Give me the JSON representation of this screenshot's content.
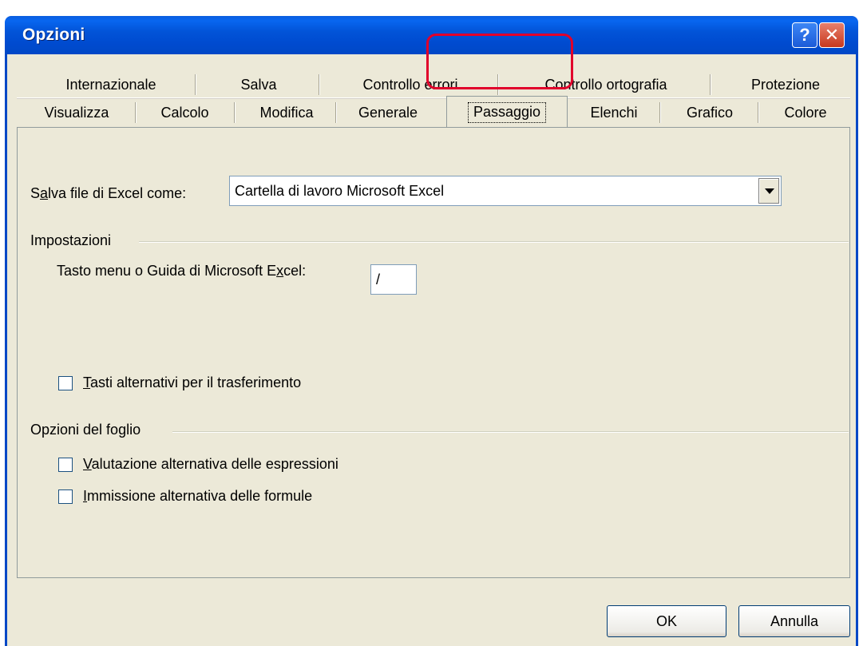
{
  "window": {
    "title": "Opzioni",
    "help_label": "?",
    "close_label": "✕"
  },
  "tabs": {
    "row1": [
      "Internazionale",
      "Salva",
      "Controllo errori",
      "Controllo ortografia",
      "Protezione"
    ],
    "row2": [
      "Visualizza",
      "Calcolo",
      "Modifica",
      "Generale",
      "Passaggio",
      "Elenchi",
      "Grafico",
      "Colore"
    ],
    "active": "Passaggio"
  },
  "transition": {
    "save_as_label_pre": "S",
    "save_as_label_ul": "a",
    "save_as_label_post": "lva file di Excel come:",
    "save_as_value": "Cartella di lavoro Microsoft Excel",
    "settings_group": "Impostazioni",
    "menu_key_label_pre": "Tasto menu o Guida di Microsoft E",
    "menu_key_label_ul": "x",
    "menu_key_label_post": "cel:",
    "menu_key_value": "/",
    "alt_nav_ul": "T",
    "alt_nav_rest": "asti alternativi per il trasferimento",
    "sheet_group": "Opzioni del foglio",
    "alt_eval_ul": "V",
    "alt_eval_rest": "alutazione alternativa delle espressioni",
    "alt_entry_ul": "I",
    "alt_entry_rest": "mmissione alternativa delle formule"
  },
  "buttons": {
    "ok": "OK",
    "cancel": "Annulla"
  }
}
